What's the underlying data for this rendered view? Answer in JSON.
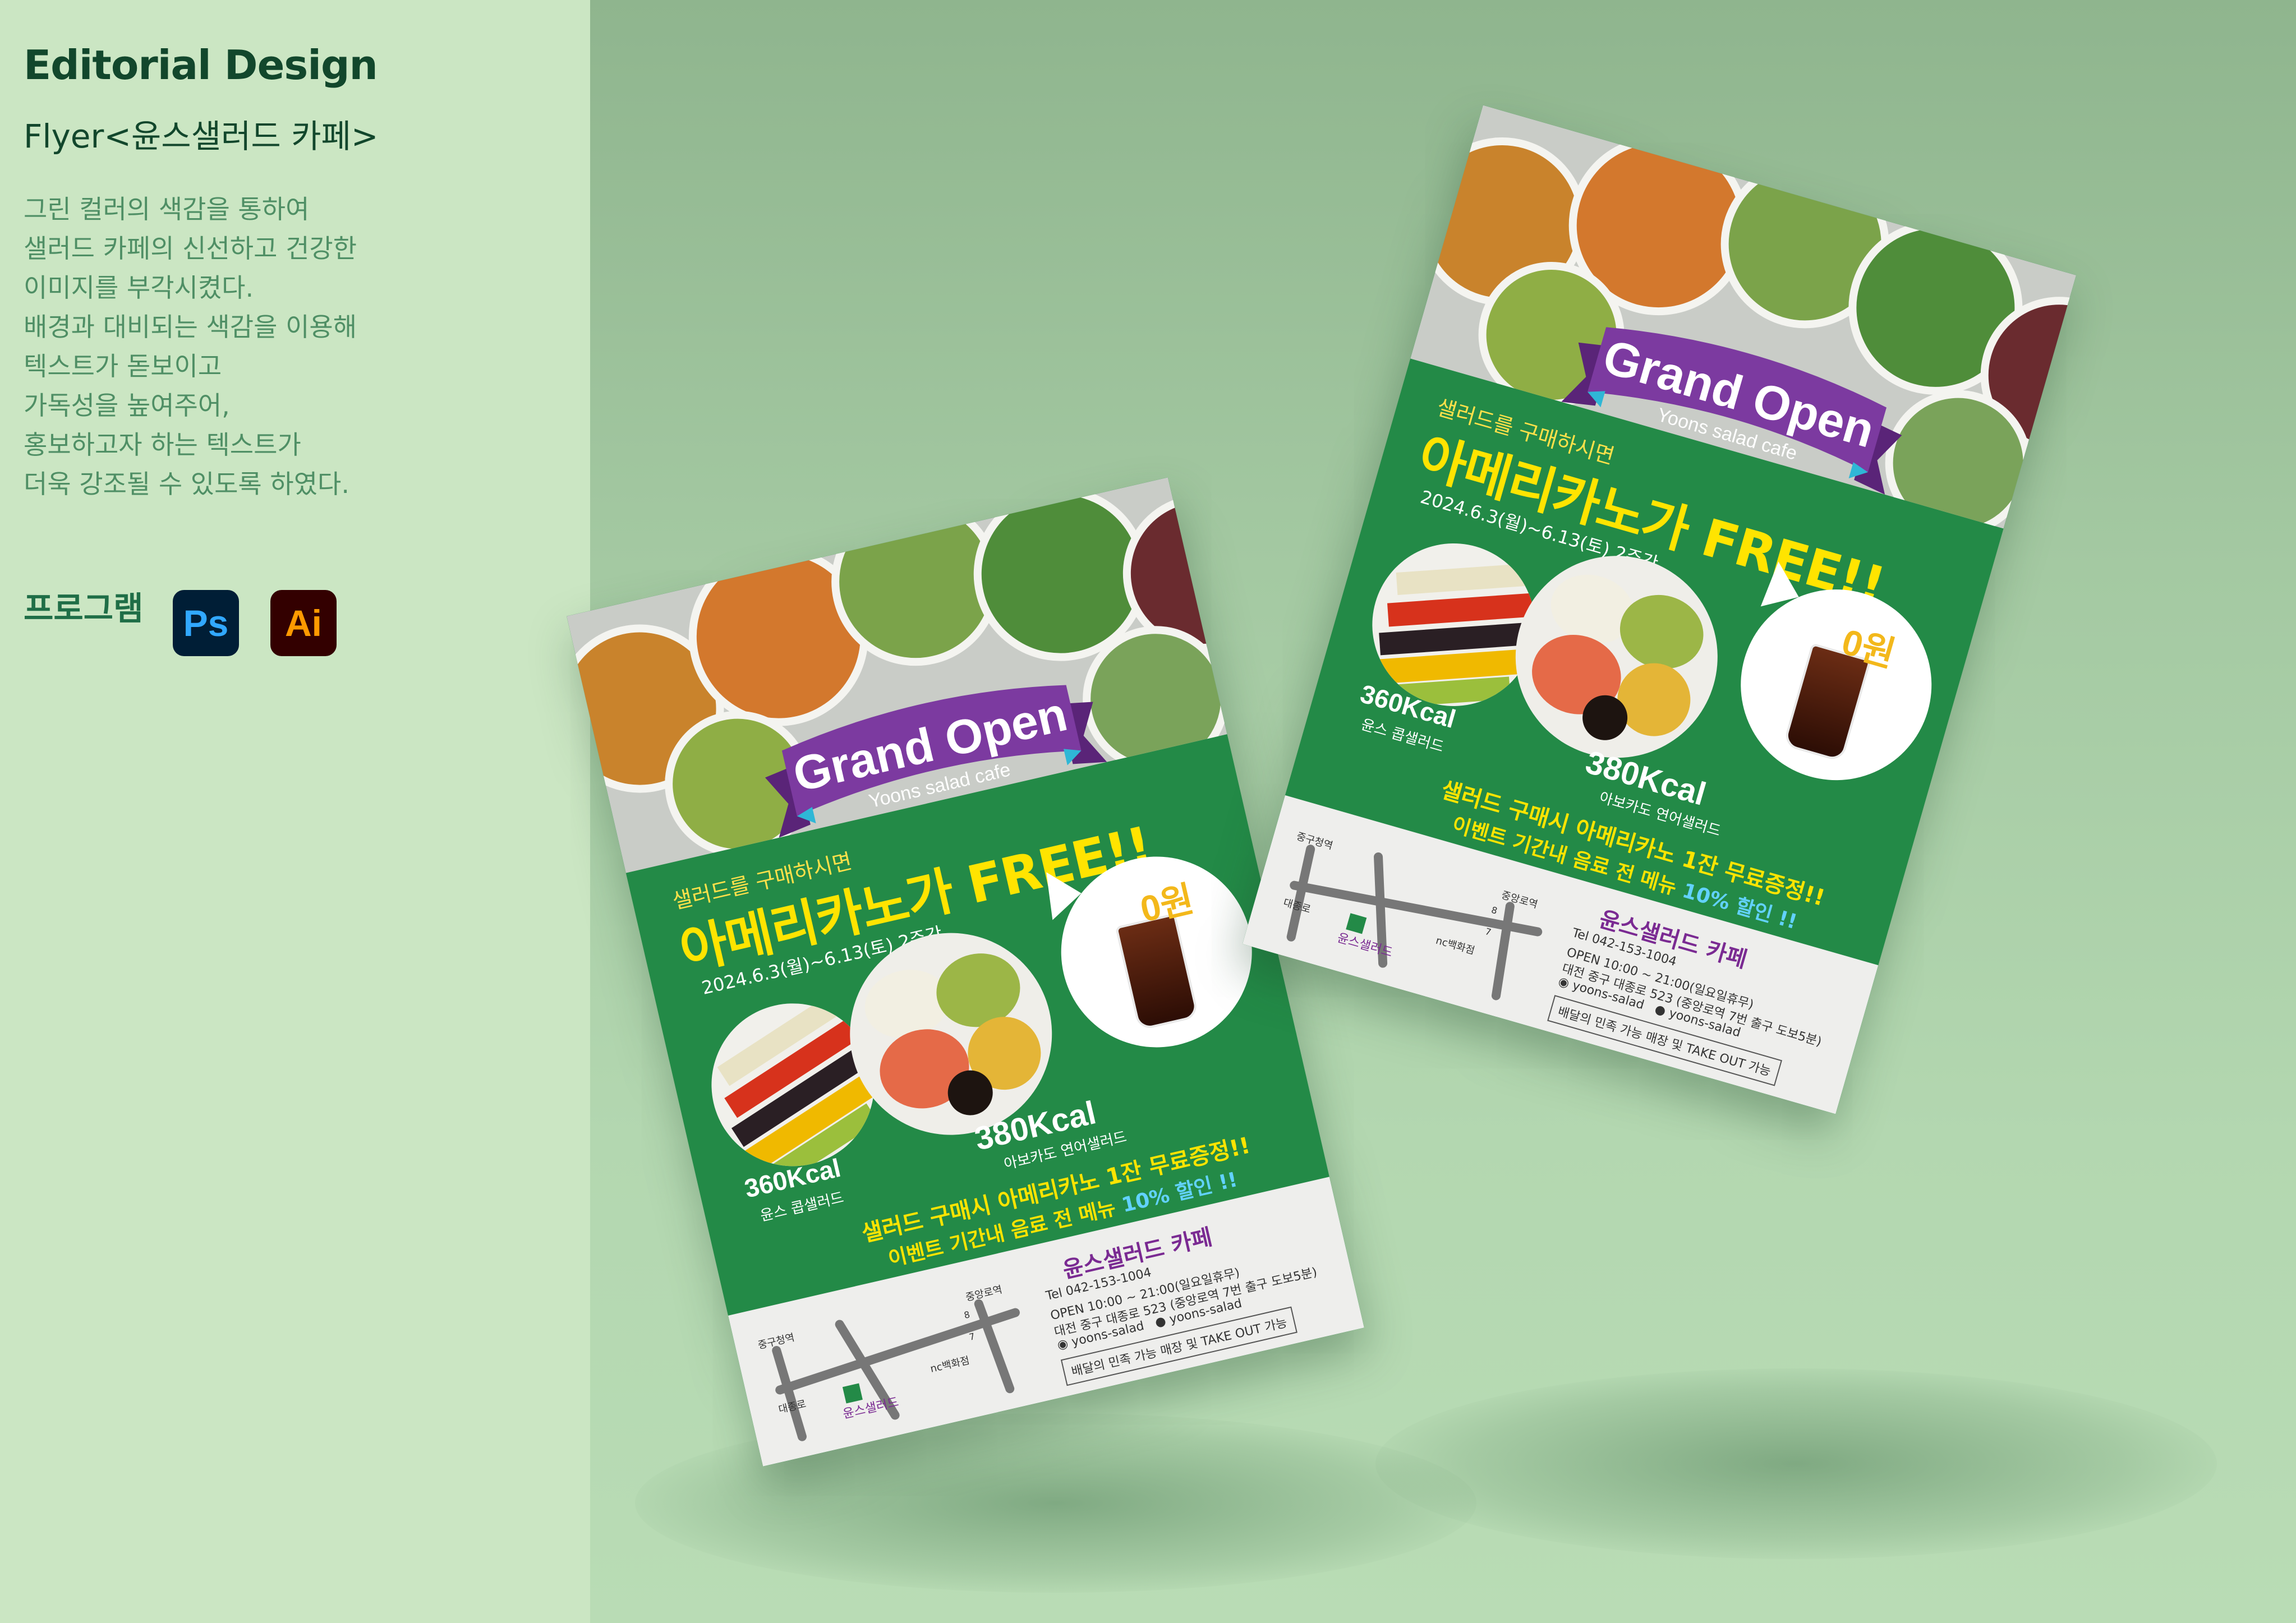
{
  "panel": {
    "title": "Editorial Design",
    "subtitle": "Flyer<윤스샐러드 카페>",
    "description": [
      "그린 컬러의 색감을 통하여",
      "샐러드 카페의 신선하고 건강한",
      "이미지를 부각시켰다.",
      "배경과 대비되는 색감을 이용해",
      "텍스트가 돋보이고",
      "가독성을 높여주어,",
      "홍보하고자 하는 텍스트가",
      "더욱 강조될 수 있도록 하였다."
    ],
    "program_label": "프로그램",
    "apps": [
      {
        "label": "Ps",
        "icon": "photoshop-icon",
        "bg": "#001e36",
        "fg": "#31a8ff"
      },
      {
        "label": "Ai",
        "icon": "illustrator-icon",
        "bg": "#330000",
        "fg": "#ff9a00"
      }
    ]
  },
  "flyer": {
    "headline": "Grand Open",
    "cafe_en": "Yoons salad cafe",
    "promo_sub": "샐러드를 구매하시면",
    "promo_main": "아메리카노가 FREE!!",
    "promo_date": "2024.6.3(월)~6.13(토) 2주간",
    "zero_price": "0원",
    "salad1_kcal": "360Kcal",
    "salad1_name": "윤스 콥샐러드",
    "salad2_kcal": "380Kcal",
    "salad2_name": "아보카도 연어샐러드",
    "event_line1": "샐러드 구매시 아메리카노 1잔 무료증정!!",
    "event_line2_prefix": "이벤트 기간내 음료 전 메뉴",
    "event_line2_highlight": "10% 할인 !!",
    "shop_name": "윤스샐러드 카페",
    "tel": "Tel 042-153-1004",
    "open": "OPEN 10:00 ~ 21:00(일요일휴무)",
    "address": "대전 중구 대종로 523 (중앙로역 7번 출구 도보5분)",
    "instagram": "yoons-salad",
    "kakao": "yoons-salad",
    "service": "배달의 민족 가능 매장 및 TAKE OUT 가능",
    "map_labels": {
      "station_a": "중구청역",
      "road": "대종로",
      "shop": "윤스샐러드",
      "landmark": "nc백화점",
      "station_b": "중앙로역",
      "exit_8": "8",
      "exit_7": "7"
    }
  },
  "colors": {
    "panel_bg": "#cbe6c3",
    "flyer_green": "#238a47",
    "ribbon_purple": "#7c3aa0",
    "promo_yellow": "#ffe400"
  }
}
